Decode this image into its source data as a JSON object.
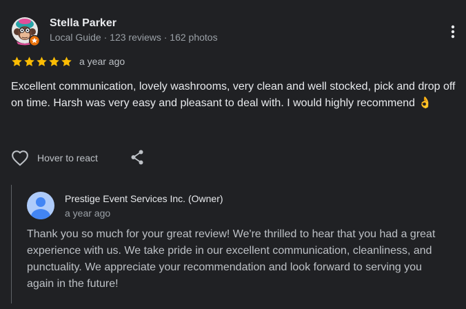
{
  "review": {
    "reviewer": {
      "name": "Stella Parker",
      "meta": "Local Guide · 123 reviews · 162 photos",
      "avatar_icon": "monkey-avatar-icon",
      "badge_icon": "local-guide-badge-icon"
    },
    "rating": {
      "stars": 5,
      "max": 5,
      "color": "#fbbc04"
    },
    "date": "a year ago",
    "text": "Excellent communication, lovely washrooms, very clean and well stocked, pick and drop off on time. Harsh was very easy and pleasant to deal with. I would highly recommend 👌",
    "actions": {
      "react_label": "Hover to react",
      "react_icon": "heart-outline-icon",
      "share_icon": "share-icon",
      "more_icon": "more-vertical-icon"
    }
  },
  "owner_reply": {
    "name": "Prestige Event Services Inc. (Owner)",
    "date": "a year ago",
    "avatar_icon": "default-user-avatar-icon",
    "text": "Thank you so much for your great review! We're thrilled to hear that you had a great experience with us. We take pride in our excellent communication, cleanliness, and punctuality. We appreciate your recommendation and look forward to serving you again in the future!"
  },
  "colors": {
    "background": "#202124",
    "star": "#fbbc04",
    "owner_avatar_bg": "#aecbfa",
    "owner_avatar_fg": "#4285f4",
    "badge": "#e8710a"
  }
}
